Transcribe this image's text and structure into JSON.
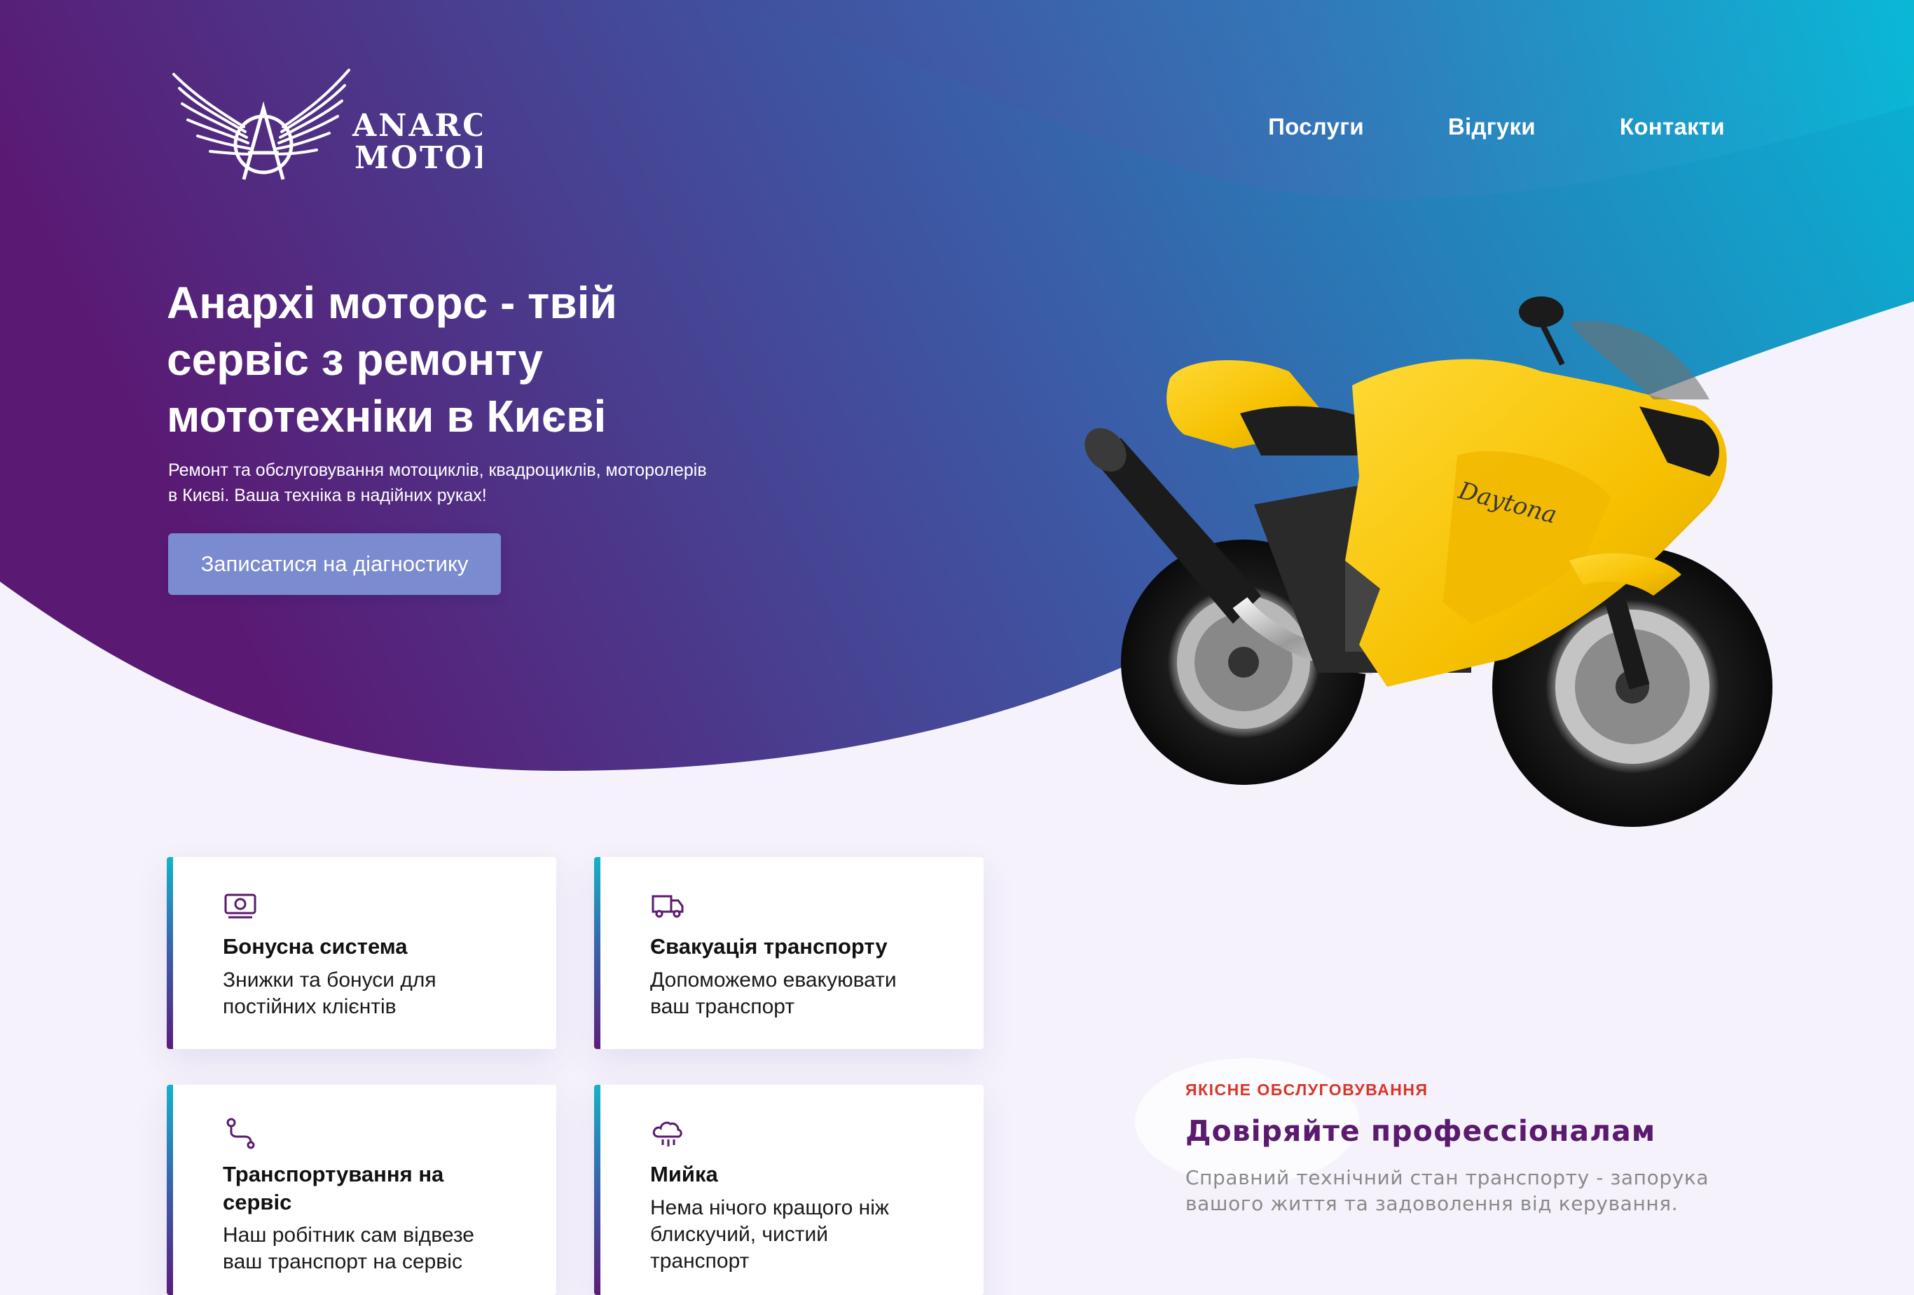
{
  "header": {
    "logo": {
      "line1": "ANARCHY",
      "line2": "MOTORS"
    },
    "nav": [
      {
        "label": "Послуги"
      },
      {
        "label": "Відгуки"
      },
      {
        "label": "Контакти"
      }
    ]
  },
  "hero": {
    "title_lines": [
      "Анархі моторс - твій",
      "сервіс з ремонту",
      "мототехніки в Києві"
    ],
    "subtitle_lines": [
      "Ремонт та обслуговування мотоциклів, квадроциклів, моторолерів",
      "в Києві. Ваша техніка в надійних руках!"
    ],
    "cta_label": "Записатися на діагностику"
  },
  "features": [
    {
      "icon": "money-icon",
      "title_lines": [
        "Бонусна система"
      ],
      "text_lines": [
        "Знижки та бонуси для",
        "постійних клієнтів"
      ]
    },
    {
      "icon": "truck-icon",
      "title_lines": [
        "Євакуація транспорту"
      ],
      "text_lines": [
        "Допоможемо евакуювати",
        "ваш транспорт"
      ]
    },
    {
      "icon": "route-icon",
      "title_lines": [
        "Транспортування на",
        "сервіс"
      ],
      "text_lines": [
        "Наш робітник сам відвезе",
        "ваш транспорт на сервіс"
      ]
    },
    {
      "icon": "cloud-rain-icon",
      "title_lines": [
        "Мийка"
      ],
      "text_lines": [
        "Нема нічого кращого ніж",
        "блискучий, чистий",
        "транспорт"
      ]
    }
  ],
  "trust": {
    "kicker": "ЯКІСНЕ ОБСЛУГОВУВАННЯ",
    "title": "Довіряйте профессіоналам",
    "text_lines": [
      "Справний технічний стан транспорту - запорука",
      "вашого життя та задоволення від керування."
    ]
  },
  "colors": {
    "gradient_start": "#5a1a74",
    "gradient_mid": "#3a5ea8",
    "gradient_end": "#07b3d3",
    "cta": "#7b8bd0",
    "kicker": "#d8352a",
    "trust_title": "#5b1a6e"
  }
}
